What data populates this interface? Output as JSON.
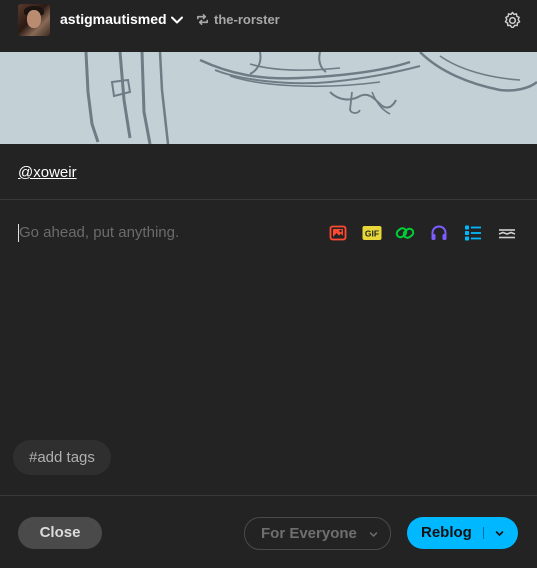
{
  "header": {
    "blog_name": "astigmautismed",
    "reblog_from": "the-rorster"
  },
  "post": {
    "mention": "@xoweir",
    "placeholder": "Go ahead, put anything.",
    "toolbar_icons": [
      "image-icon",
      "gif-icon",
      "link-icon",
      "audio-icon",
      "list-icon",
      "more-icon"
    ],
    "gif_label": "GIF",
    "tags_placeholder": "#add tags"
  },
  "footer": {
    "close_label": "Close",
    "audience_label": "For Everyone",
    "reblog_label": "Reblog"
  },
  "colors": {
    "background": "#232323",
    "accent": "#00b8ff",
    "image_tool": "#ff4930",
    "gif_tool": "#e8d738",
    "link_tool": "#00cf35",
    "audio_tool": "#7c5cff",
    "list_tool": "#00b8ff"
  }
}
